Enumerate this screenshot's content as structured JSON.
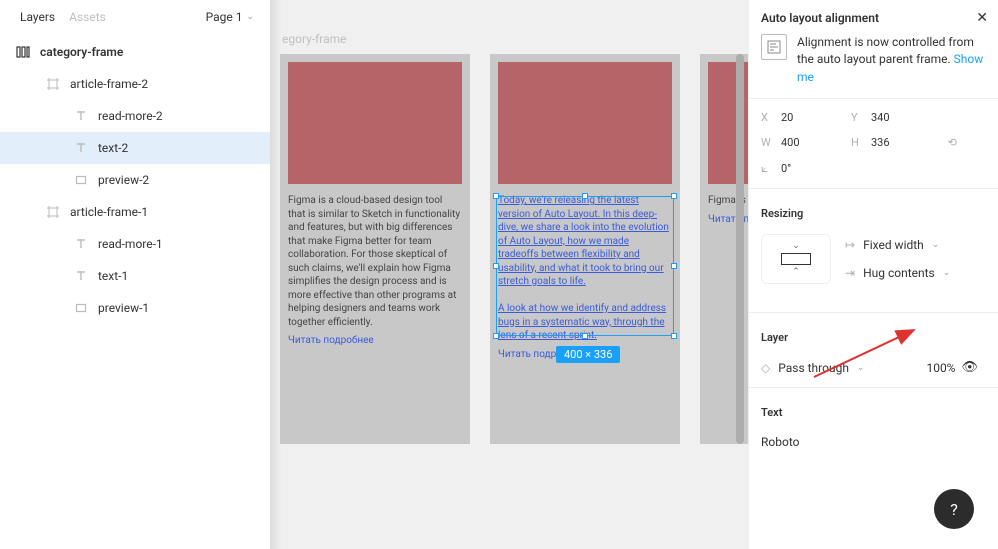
{
  "left": {
    "tabs": {
      "layers": "Layers",
      "assets": "Assets"
    },
    "page": "Page 1",
    "tree": {
      "root": "category-frame",
      "items": [
        {
          "name": "article-frame-2",
          "indent": 1,
          "icon": "frame"
        },
        {
          "name": "read-more-2",
          "indent": 2,
          "icon": "text"
        },
        {
          "name": "text-2",
          "indent": 2,
          "icon": "text",
          "selected": true
        },
        {
          "name": "preview-2",
          "indent": 2,
          "icon": "rect"
        },
        {
          "name": "article-frame-1",
          "indent": 1,
          "icon": "frame"
        },
        {
          "name": "read-more-1",
          "indent": 2,
          "icon": "text"
        },
        {
          "name": "text-1",
          "indent": 2,
          "icon": "text"
        },
        {
          "name": "preview-1",
          "indent": 2,
          "icon": "rect"
        }
      ]
    }
  },
  "canvas": {
    "frame_label": "egory-frame",
    "article1_text": "Figma is a cloud-based design tool that is similar to Sketch in functionality and features, but with big differences that make Figma better for team collaboration. For those skeptical of such claims, we'll explain how Figma simplifies the design process and is more effective than other programs at helping designers and teams work together efficiently.",
    "article2_text": "Today, we're releasing the latest version of Auto Layout. In this deep-dive, we share a look into the evolution of Auto Layout, how we made tradeoffs between flexibility and usability, and what it took to bring our stretch goals to life.\n\nA look at how we identify and address bugs in a systematic way, through the lens of a recent sprint.",
    "article3_text": "Figma is a primarily vector graphics prototyping tool offline features applications for Windows.",
    "read_more": "Читать подробнее",
    "read_more_cut": "Читать подр",
    "dim_badge": "400 × 336"
  },
  "right": {
    "header": "Auto layout alignment",
    "info_text": "Alignment is now controlled from the auto layout parent frame.",
    "show_me": "Show me",
    "coords": {
      "x_label": "X",
      "x": "20",
      "y_label": "Y",
      "y": "340",
      "w_label": "W",
      "w": "400",
      "h_label": "H",
      "h": "336",
      "rot": "0°"
    },
    "resizing_title": "Resizing",
    "width_mode": "Fixed width",
    "height_mode": "Hug contents",
    "layer_title": "Layer",
    "blend": "Pass through",
    "opacity": "100%",
    "text_title": "Text",
    "font": "Roboto"
  }
}
